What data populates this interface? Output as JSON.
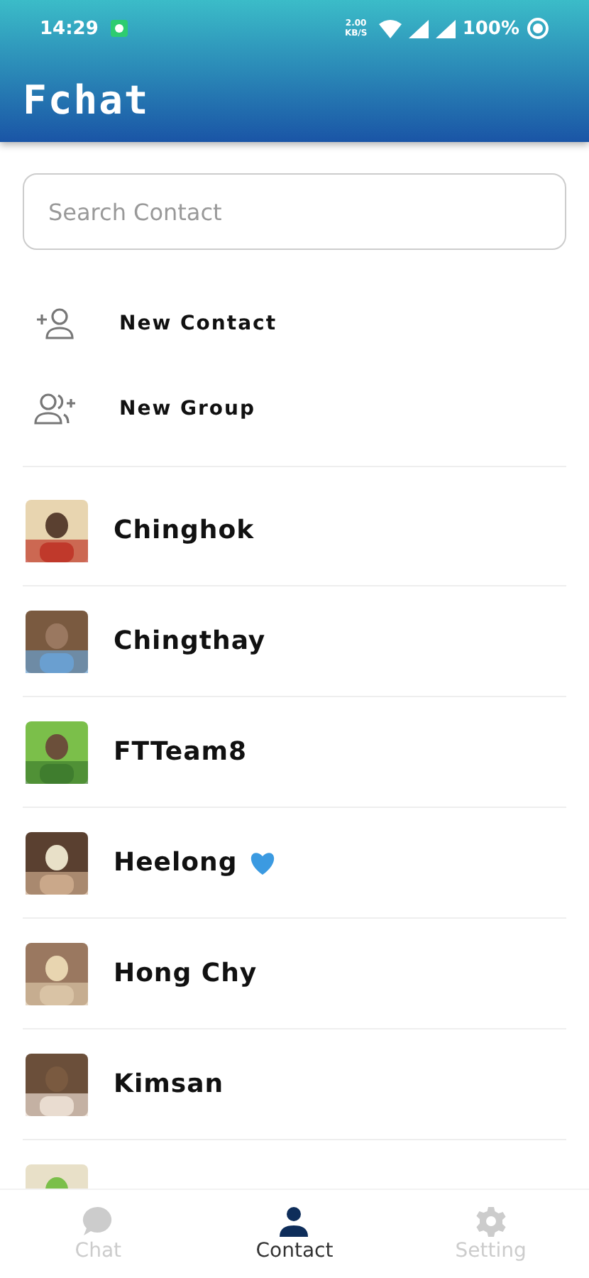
{
  "status_bar": {
    "time": "14:29",
    "net_speed": "2.00 KB/S",
    "battery": "100%"
  },
  "app_bar": {
    "title": "Fchat"
  },
  "search": {
    "placeholder": "Search Contact"
  },
  "actions": [
    {
      "kind": "add_contact",
      "label": "New Contact"
    },
    {
      "kind": "add_group",
      "label": "New Group"
    }
  ],
  "contacts": [
    {
      "name": "Chinghok",
      "heart": false
    },
    {
      "name": "Chingthay",
      "heart": false
    },
    {
      "name": "FTTeam8",
      "heart": false
    },
    {
      "name": "Heelong",
      "heart": true
    },
    {
      "name": "Hong Chy",
      "heart": false
    },
    {
      "name": "Kimsan",
      "heart": false
    },
    {
      "kind": "partial"
    }
  ],
  "bottom_nav": [
    {
      "label": "Chat",
      "selected": false
    },
    {
      "label": "Contact",
      "selected": true
    },
    {
      "label": "Setting",
      "selected": false
    }
  ]
}
